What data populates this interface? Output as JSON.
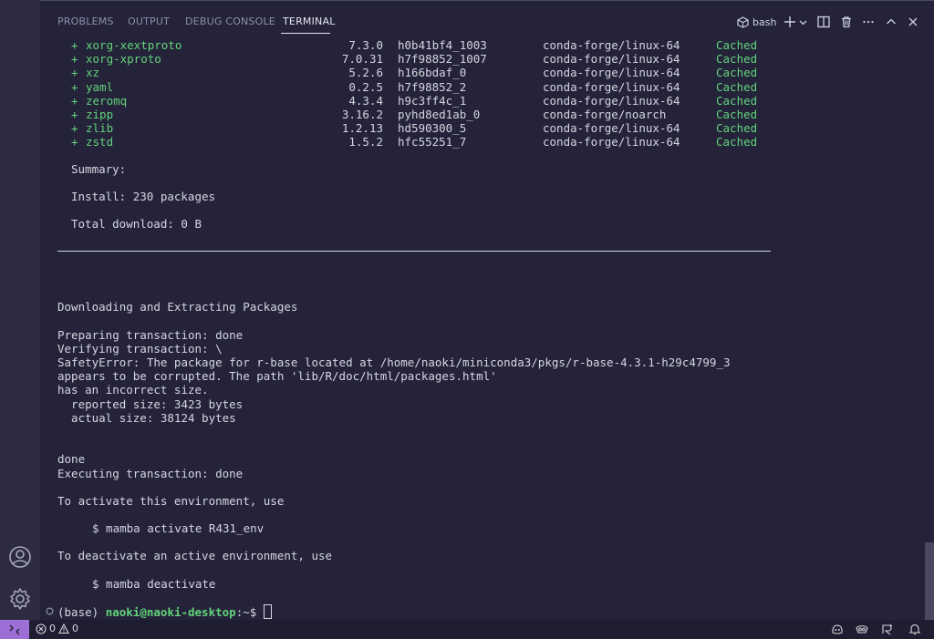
{
  "tabs": [
    {
      "label": "PROBLEMS"
    },
    {
      "label": "OUTPUT"
    },
    {
      "label": "DEBUG CONSOLE"
    },
    {
      "label": "TERMINAL"
    }
  ],
  "toolbar": {
    "shell_label": "bash"
  },
  "packages": [
    {
      "name": "xorg-xextproto",
      "version": "7.3.0",
      "build": "h0b41bf4_1003",
      "channel": "conda-forge/linux-64",
      "status": "Cached"
    },
    {
      "name": "xorg-xproto",
      "version": "7.0.31",
      "build": "h7f98852_1007",
      "channel": "conda-forge/linux-64",
      "status": "Cached"
    },
    {
      "name": "xz",
      "version": "5.2.6",
      "build": "h166bdaf_0",
      "channel": "conda-forge/linux-64",
      "status": "Cached"
    },
    {
      "name": "yaml",
      "version": "0.2.5",
      "build": "h7f98852_2",
      "channel": "conda-forge/linux-64",
      "status": "Cached"
    },
    {
      "name": "zeromq",
      "version": "4.3.4",
      "build": "h9c3ff4c_1",
      "channel": "conda-forge/linux-64",
      "status": "Cached"
    },
    {
      "name": "zipp",
      "version": "3.16.2",
      "build": "pyhd8ed1ab_0",
      "channel": "conda-forge/noarch",
      "status": "Cached"
    },
    {
      "name": "zlib",
      "version": "1.2.13",
      "build": "hd590300_5",
      "channel": "conda-forge/linux-64",
      "status": "Cached"
    },
    {
      "name": "zstd",
      "version": "1.5.2",
      "build": "hfc55251_7",
      "channel": "conda-forge/linux-64",
      "status": "Cached"
    }
  ],
  "package_prefix": "+",
  "summary": {
    "heading": "Summary:",
    "install": "Install: 230 packages",
    "download": "Total download: 0 B"
  },
  "output": {
    "downloading": "Downloading and Extracting Packages",
    "preparing": "Preparing transaction: done",
    "verifying": "Verifying transaction: \\",
    "error1": "SafetyError: The package for r-base located at /home/naoki/miniconda3/pkgs/r-base-4.3.1-h29c4799_3",
    "error2": "appears to be corrupted. The path 'lib/R/doc/html/packages.html'",
    "error3": "has an incorrect size.",
    "reported": "  reported size: 3423 bytes",
    "actual": "  actual size: 38124 bytes",
    "done": "done",
    "executing": "Executing transaction: done",
    "activate_info": "To activate this environment, use",
    "activate_cmd": "$ mamba activate R431_env",
    "deactivate_info": "To deactivate an active environment, use",
    "deactivate_cmd": "$ mamba deactivate"
  },
  "prompt": {
    "env": "(base)",
    "user_host": "naoki@naoki-desktop",
    "path_symbol": ":~$"
  },
  "status_bar": {
    "errors": "0",
    "warnings": "0"
  }
}
